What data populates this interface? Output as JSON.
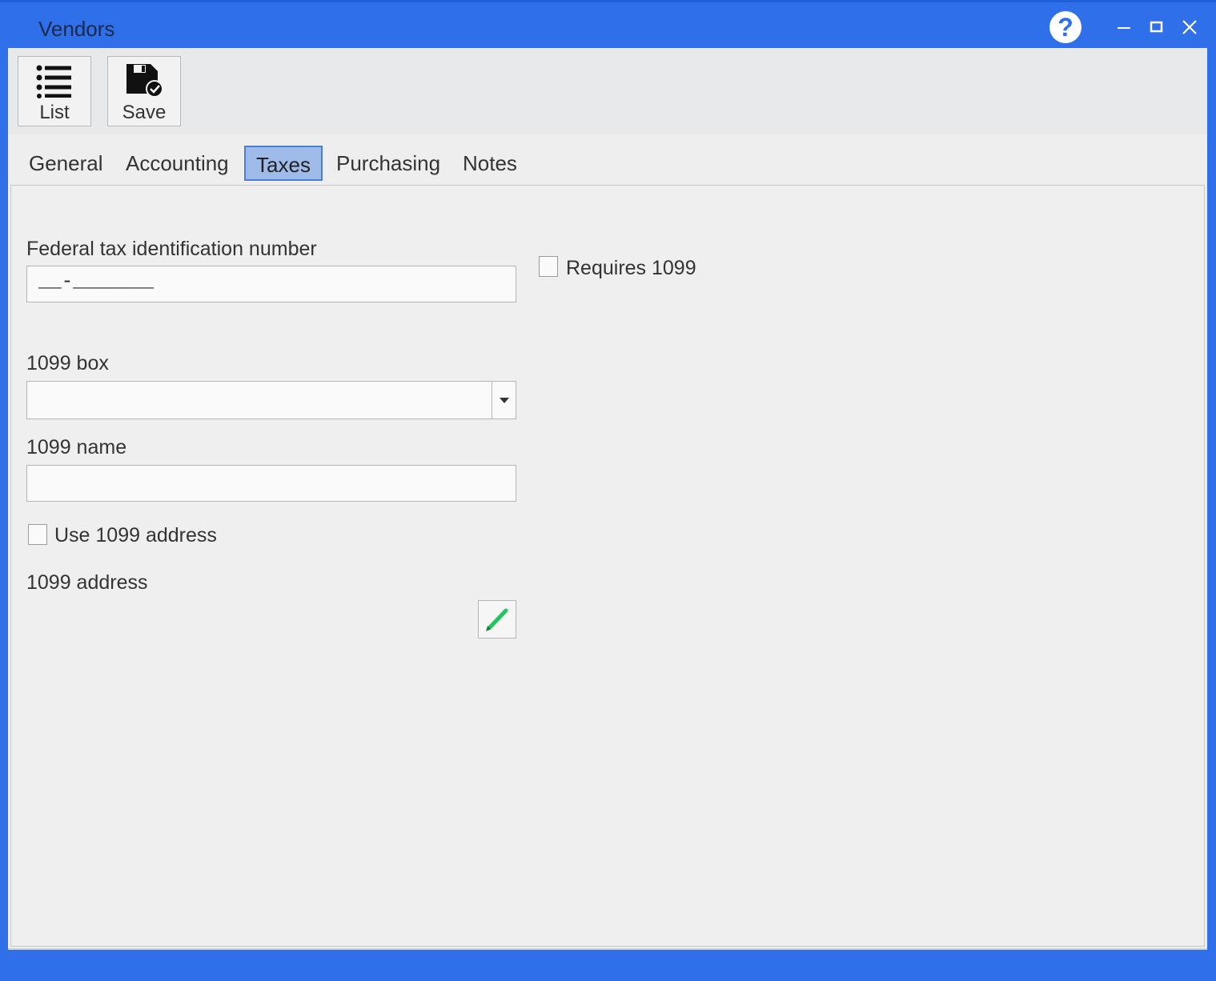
{
  "window": {
    "title": "Vendors",
    "help_label": "?",
    "accent_color": "#2f6fea"
  },
  "toolbar": {
    "list_label": "List",
    "list_icon": "list-icon",
    "save_label": "Save",
    "save_icon": "save-disk-icon"
  },
  "tabs": [
    {
      "label": "General",
      "active": false
    },
    {
      "label": "Accounting",
      "active": false
    },
    {
      "label": "Taxes",
      "active": true
    },
    {
      "label": "Purchasing",
      "active": false
    },
    {
      "label": "Notes",
      "active": false
    }
  ],
  "form": {
    "tax_id_label": "Federal tax identification number",
    "tax_id_value": "__-_______",
    "requires_1099_label": "Requires 1099",
    "requires_1099_checked": false,
    "box_1099_label": "1099 box",
    "box_1099_value": "",
    "name_1099_label": "1099 name",
    "name_1099_value": "",
    "use_address_label": "Use 1099 address",
    "use_address_checked": false,
    "address_label": "1099 address",
    "edit_icon": "pencil-icon"
  }
}
